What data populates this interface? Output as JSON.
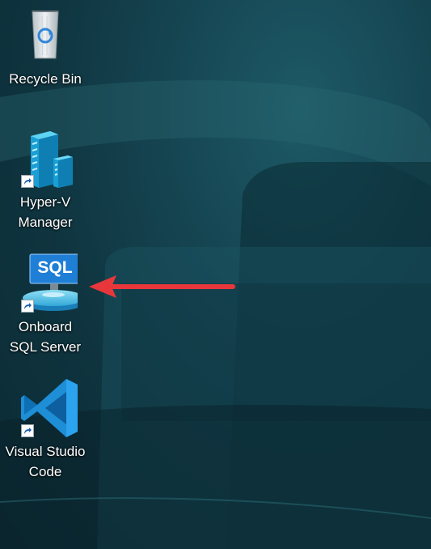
{
  "desktop": {
    "icons": [
      {
        "id": "recycle-bin",
        "line1": "Recycle Bin",
        "line2": "",
        "icon": "recycle-bin-icon",
        "shortcut": false
      },
      {
        "id": "hyperv-manager",
        "line1": "Hyper-V",
        "line2": "Manager",
        "icon": "server-stack-icon",
        "shortcut": true
      },
      {
        "id": "onboard-sql",
        "line1": "Onboard",
        "line2": "SQL Server",
        "icon": "sql-server-icon",
        "shortcut": true
      },
      {
        "id": "vscode",
        "line1": "Visual Studio",
        "line2": "Code",
        "icon": "vscode-icon",
        "shortcut": true
      }
    ],
    "sql_badge_text": "SQL"
  },
  "annotation": {
    "arrow_color": "#e8373b",
    "points_to": "Onboard SQL Server"
  },
  "colors": {
    "wallpaper": "#0e3440",
    "label_text": "#ffffff"
  }
}
